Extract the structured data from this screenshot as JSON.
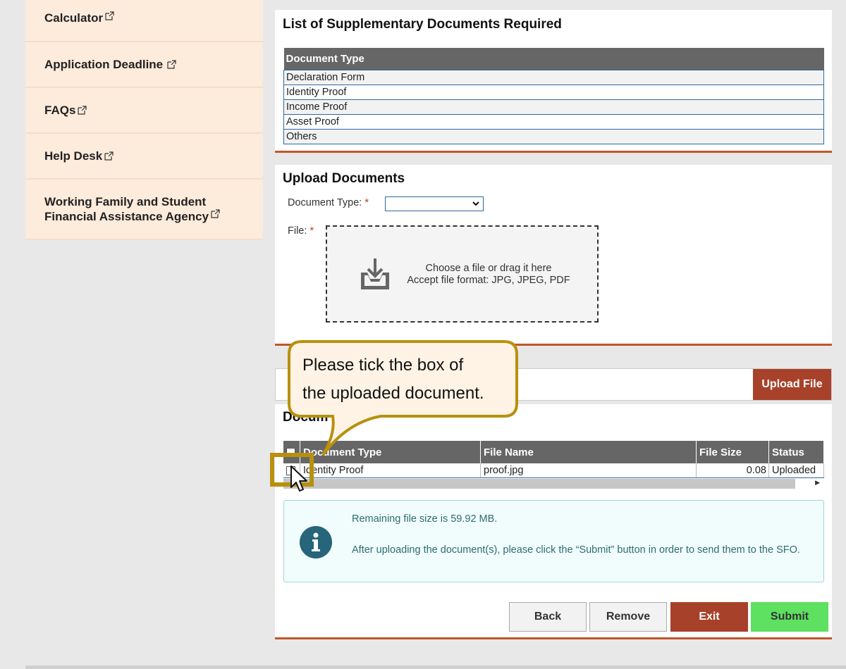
{
  "sidebar": {
    "items": [
      {
        "label": "Calculator"
      },
      {
        "label": "Application Deadline"
      },
      {
        "label": "FAQs"
      },
      {
        "label": "Help Desk"
      },
      {
        "label_line1": "Working Family and Student",
        "label_line2": "Financial Assistance Agency"
      }
    ]
  },
  "supplementary": {
    "title": "List of Supplementary Documents Required",
    "column_header": "Document Type",
    "rows": [
      "Declaration Form",
      "Identity Proof",
      "Income Proof",
      "Asset Proof",
      "Others"
    ]
  },
  "upload": {
    "title": "Upload Documents",
    "doc_type_label": "Document Type:",
    "file_label": "File:",
    "required_mark": "*",
    "doc_type_value": "",
    "dropzone_line1": "Choose a file or drag it here",
    "dropzone_line2": "Accept file format: JPG, JPEG, PDF",
    "upload_button": "Upload File"
  },
  "documents": {
    "title": "Docum",
    "columns": [
      "Document Type",
      "File Name",
      "File Size",
      "Status"
    ],
    "rows": [
      {
        "type": "Identity Proof",
        "file": "proof.jpg",
        "size": "0.08",
        "status": "Uploaded"
      }
    ]
  },
  "info": {
    "remaining": "Remaining file size is 59.92 MB.",
    "instruction": "After uploading the document(s), please click the “Submit” button in order to send them to the SFO."
  },
  "buttons": {
    "back": "Back",
    "remove": "Remove",
    "exit": "Exit",
    "submit": "Submit"
  },
  "callout": {
    "line1": "Please tick the box of",
    "line2": "the uploaded document."
  },
  "colors": {
    "accent": "#c0562a",
    "exit": "#a8412a",
    "submit": "#5ee060",
    "header": "#666666",
    "callout_border": "#b8900e"
  }
}
